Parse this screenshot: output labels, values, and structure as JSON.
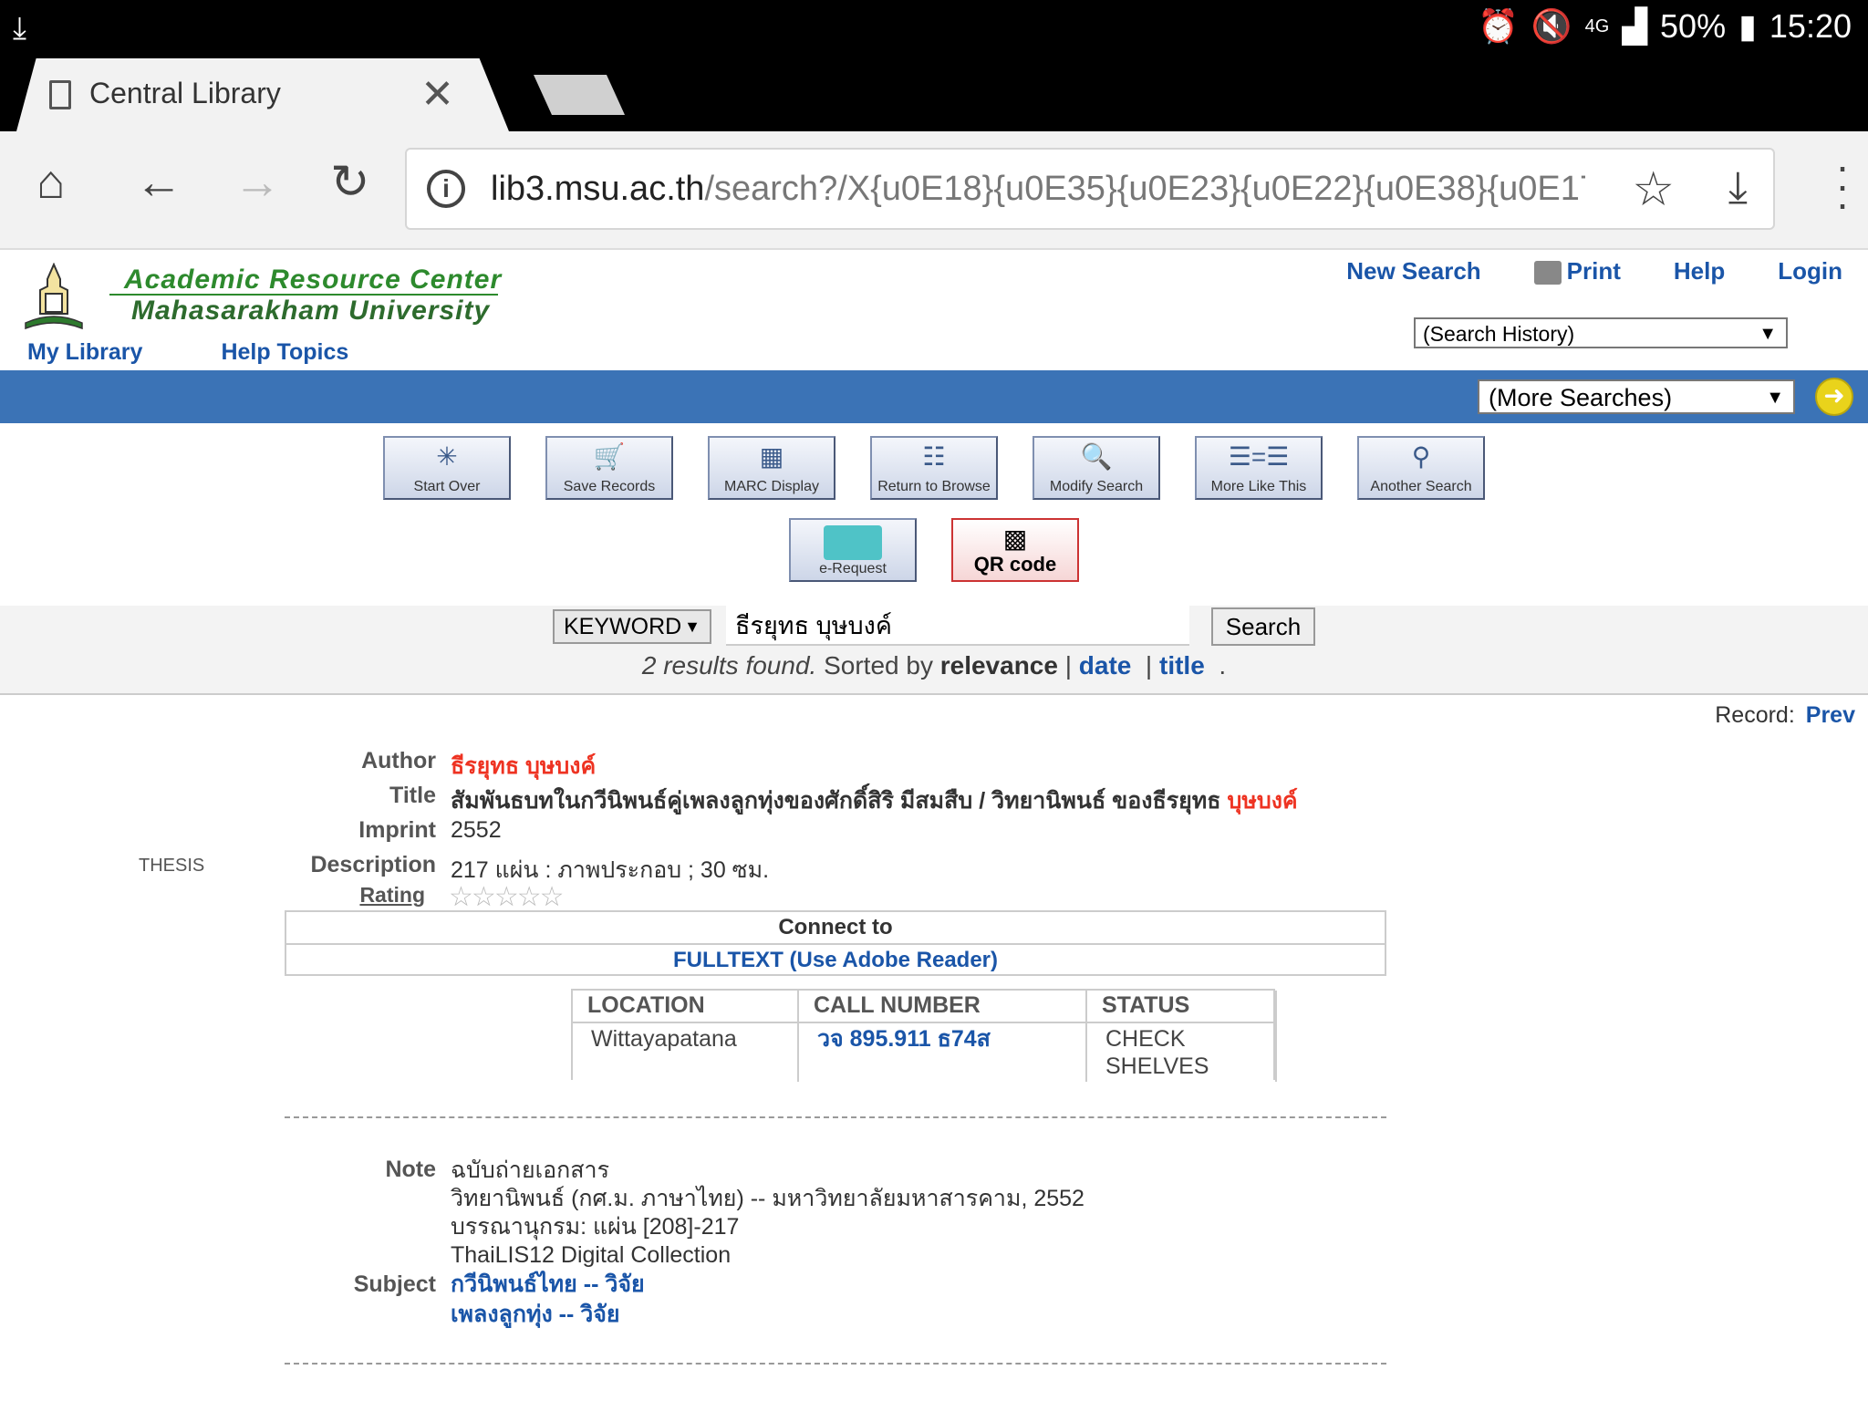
{
  "status_bar": {
    "time": "15:20",
    "battery": "50%",
    "network": "4G"
  },
  "browser": {
    "tab_title": "Central Library",
    "url_host": "lib3.msu.ac.th",
    "url_path": "/search?/X{u0E18}{u0E35}{u0E23}{u0E22}{u0E38}{u0E17}{u0E"
  },
  "header": {
    "brand_line1": "Academic Resource Center",
    "brand_line2": "Mahasarakham University",
    "links": {
      "new_search": "New Search",
      "print": "Print",
      "help": "Help",
      "login": "Login"
    },
    "subnav": {
      "my_library": "My Library",
      "help_topics": "Help Topics"
    },
    "search_history": "(Search History)",
    "more_searches": "(More Searches)"
  },
  "toolbar_buttons": [
    {
      "label": "Start Over",
      "icon": "star-burst-icon"
    },
    {
      "label": "Save Records",
      "icon": "cart-icon"
    },
    {
      "label": "MARC Display",
      "icon": "grid-icon"
    },
    {
      "label": "Return to Browse",
      "icon": "browse-icon"
    },
    {
      "label": "Modify Search",
      "icon": "magnifier-icon"
    },
    {
      "label": "More Like This",
      "icon": "list-icon"
    },
    {
      "label": "Another Search",
      "icon": "search-icon"
    }
  ],
  "toolbar_buttons2": [
    {
      "label": "e-Request",
      "icon": "envelope-icon"
    },
    {
      "label": "QR code",
      "icon": "qr-code-icon"
    }
  ],
  "search": {
    "scope": "KEYWORD",
    "query": "ธีรยุทธ บุษบงค์",
    "button": "Search",
    "results_count": "2 results found.",
    "sorted_by": "Sorted by",
    "sort_relevance": "relevance",
    "sort_date": "date",
    "sort_title": "title"
  },
  "record_nav": {
    "label": "Record:",
    "prev": "Prev"
  },
  "record": {
    "material_type": "THESIS",
    "labels": {
      "author": "Author",
      "title": "Title",
      "imprint": "Imprint",
      "description": "Description",
      "rating": "Rating",
      "note": "Note",
      "subject": "Subject"
    },
    "author": "ธีรยุทธ บุษบงค์",
    "title_main": "สัมพันธบทในกวีนิพนธ์คู่เพลงลูกทุ่งของศักดิ์สิริ มีสมสืบ / วิทยานิพนธ์ ของธีรยุทธ ",
    "title_highlight": "บุษบงค์",
    "imprint": "2552",
    "description": "217 แผ่น : ภาพประกอบ ; 30 ซม.",
    "rating_stars": 0,
    "connect_to": "Connect to",
    "fulltext": "FULLTEXT (Use Adobe Reader)",
    "holdings": {
      "headers": [
        "LOCATION",
        "CALL NUMBER",
        "STATUS"
      ],
      "location": "Wittayapatana",
      "call_number": "วจ 895.911 ธ74ส",
      "status_line1": "CHECK",
      "status_line2": "SHELVES"
    },
    "notes": [
      "ฉบับถ่ายเอกสาร",
      "วิทยานิพนธ์ (กศ.ม. ภาษาไทย) -- มหาวิทยาลัยมหาสารคาม, 2552",
      "บรรณานุกรม: แผ่น [208]-217",
      "ThaiLIS12 Digital Collection"
    ],
    "subjects": [
      "กวีนิพนธ์ไทย -- วิจัย",
      "เพลงลูกทุ่ง -- วิจัย"
    ]
  }
}
